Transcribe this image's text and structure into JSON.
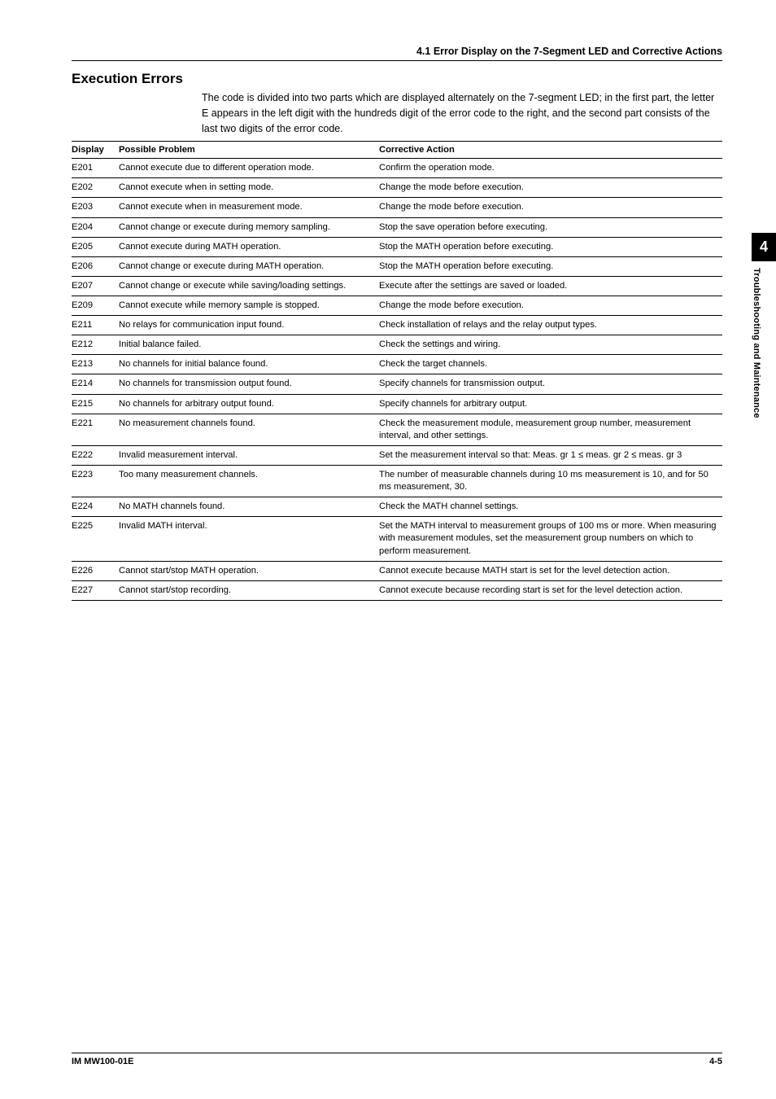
{
  "header": {
    "title": "4.1  Error Display on the 7-Segment LED and Corrective Actions"
  },
  "section": {
    "title": "Execution Errors",
    "intro": "The code is divided into two parts which are displayed alternately on the 7-segment LED; in the first part, the letter E appears in the left digit with the hundreds digit of the error code to the right, and the second part consists of the last two digits of the error code."
  },
  "table": {
    "headers": {
      "display": "Display",
      "problem": "Possible Problem",
      "action": "Corrective Action"
    },
    "rows": [
      {
        "display": "E201",
        "problem": "Cannot execute due to different operation mode.",
        "action": "Confirm the operation mode."
      },
      {
        "display": "E202",
        "problem": "Cannot execute when in setting mode.",
        "action": "Change the mode before execution."
      },
      {
        "display": "E203",
        "problem": "Cannot execute when in measurement mode.",
        "action": "Change the mode before execution."
      },
      {
        "display": "E204",
        "problem": "Cannot change or execute during memory sampling.",
        "action": "Stop the save operation before executing."
      },
      {
        "display": "E205",
        "problem": "Cannot execute during MATH operation.",
        "action": "Stop the MATH operation before executing."
      },
      {
        "display": "E206",
        "problem": "Cannot change or execute during MATH operation.",
        "action": "Stop the MATH operation before executing."
      },
      {
        "display": "E207",
        "problem": "Cannot change or execute while saving/loading settings.",
        "action": "Execute after the settings are saved or loaded."
      },
      {
        "display": "E209",
        "problem": "Cannot execute while memory sample is stopped.",
        "action": "Change the mode before execution."
      },
      {
        "display": "E211",
        "problem": "No relays for communication input found.",
        "action": "Check installation of relays and the relay output types."
      },
      {
        "display": "E212",
        "problem": "Initial balance failed.",
        "action": "Check the settings and wiring."
      },
      {
        "display": "E213",
        "problem": "No channels for initial balance found.",
        "action": "Check the target channels."
      },
      {
        "display": "E214",
        "problem": "No channels for transmission output found.",
        "action": "Specify channels for transmission output."
      },
      {
        "display": "E215",
        "problem": "No channels for arbitrary output found.",
        "action": "Specify channels for arbitrary output."
      },
      {
        "display": "E221",
        "problem": "No measurement channels found.",
        "action": "Check the measurement module, measurement group number, measurement interval, and other settings."
      },
      {
        "display": "E222",
        "problem": "Invalid measurement interval.",
        "action": "Set the measurement interval so that: Meas. gr 1 ≤ meas. gr 2 ≤ meas. gr 3"
      },
      {
        "display": "E223",
        "problem": "Too many measurement channels.",
        "action": "The number of measurable channels during 10 ms measurement is 10, and for 50 ms measurement, 30."
      },
      {
        "display": "E224",
        "problem": "No MATH channels found.",
        "action": "Check the MATH channel settings."
      },
      {
        "display": "E225",
        "problem": "Invalid MATH interval.",
        "action": "Set the MATH interval to measurement groups of  100 ms or more. When measuring with measurement modules, set the measurement group numbers on which to perform measurement."
      },
      {
        "display": "E226",
        "problem": "Cannot start/stop MATH operation.",
        "action": "Cannot execute because MATH start is set for the level detection action."
      },
      {
        "display": "E227",
        "problem": "Cannot start/stop recording.",
        "action": "Cannot execute because recording start is set for the level detection action."
      }
    ]
  },
  "sidetab": {
    "number": "4",
    "text": "Troubleshooting and Maintenance"
  },
  "footer": {
    "left": "IM MW100-01E",
    "right": "4-5"
  }
}
